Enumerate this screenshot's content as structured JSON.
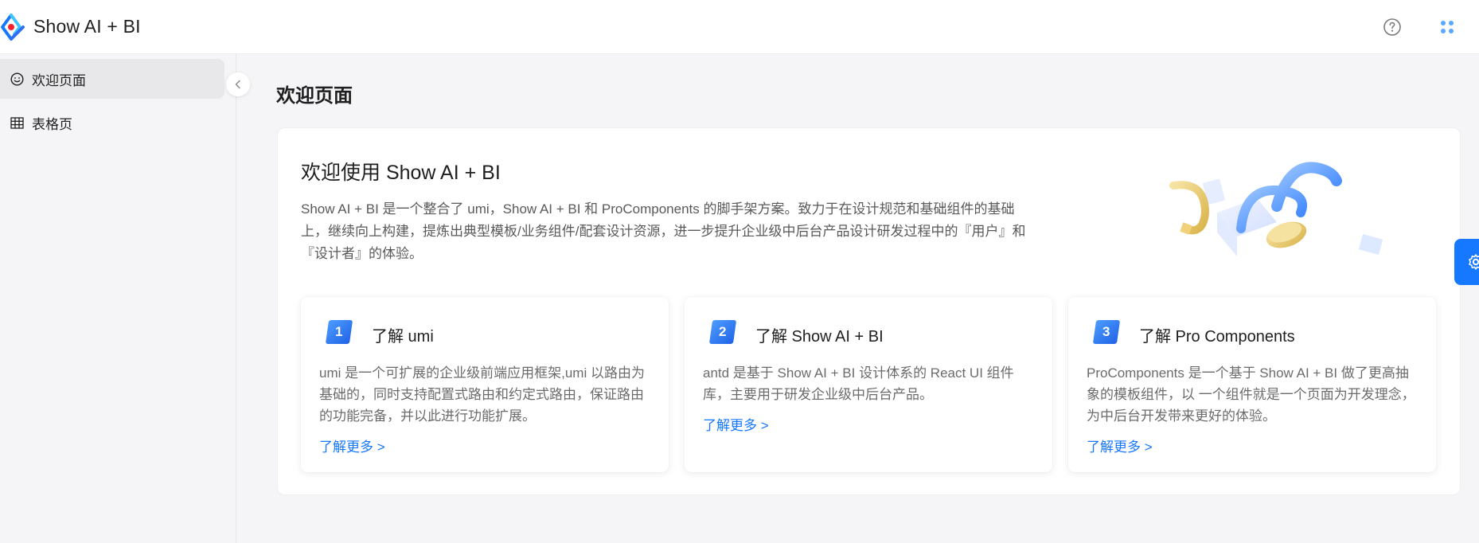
{
  "app": {
    "title": "Show AI + BI"
  },
  "header": {
    "help_icon": "question-circle-icon",
    "apps_icon": "apps-grid-icon"
  },
  "sidebar": {
    "items": [
      {
        "label": "欢迎页面",
        "icon": "smile-icon",
        "active": true
      },
      {
        "label": "表格页",
        "icon": "table-icon",
        "active": false
      }
    ]
  },
  "main": {
    "page_title": "欢迎页面",
    "welcome": {
      "heading": "欢迎使用 Show AI + BI",
      "description": "Show AI + BI 是一个整合了 umi，Show AI + BI 和 ProComponents 的脚手架方案。致力于在设计规范和基础组件的基础上，继续向上构建，提炼出典型模板/业务组件/配套设计资源，进一步提升企业级中后台产品设计研发过程中的『用户』和『设计者』的体验。"
    },
    "features": [
      {
        "index": "1",
        "title": "了解 umi",
        "desc": "umi 是一个可扩展的企业级前端应用框架,umi 以路由为基础的，同时支持配置式路由和约定式路由，保证路由的功能完备，并以此进行功能扩展。",
        "link": "了解更多 >"
      },
      {
        "index": "2",
        "title": "了解 Show AI + BI",
        "desc": "antd 是基于 Show AI + BI 设计体系的 React UI 组件库，主要用于研发企业级中后台产品。",
        "link": "了解更多 >"
      },
      {
        "index": "3",
        "title": "了解 Pro Components",
        "desc": "ProComponents 是一个基于 Show AI + BI 做了更高抽象的模板组件，以 一个组件就是一个页面为开发理念，为中后台开发带来更好的体验。",
        "link": "了解更多 >"
      }
    ]
  },
  "colors": {
    "primary": "#1677ff",
    "badge_from": "#4d9cff",
    "badge_to": "#1f63e6"
  }
}
